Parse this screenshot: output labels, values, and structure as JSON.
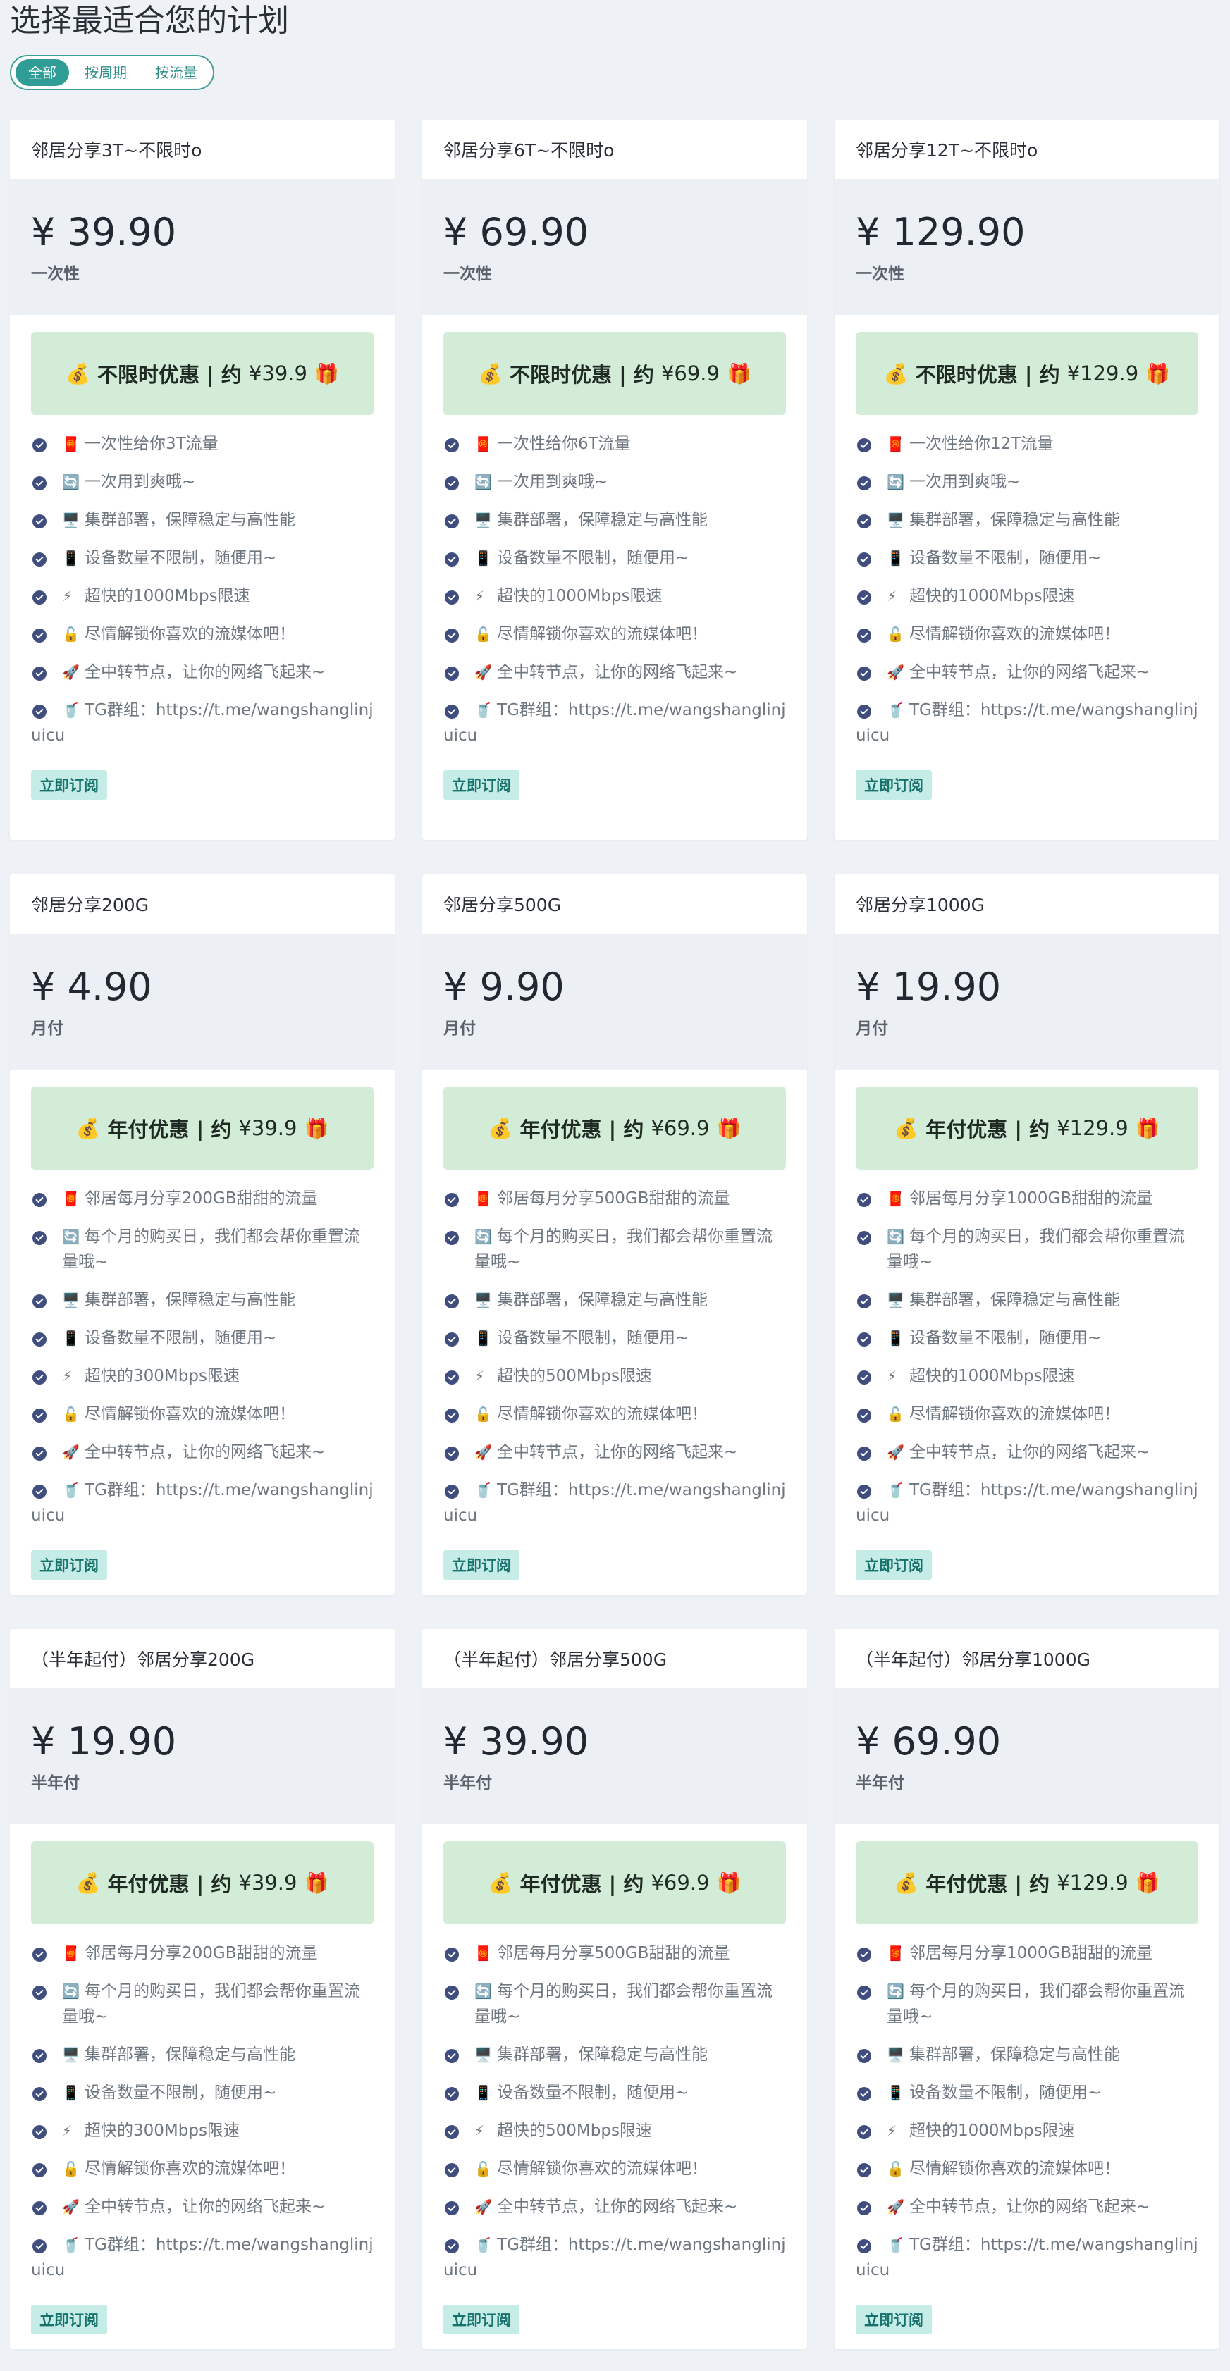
{
  "page": {
    "title": "选择最适合您的计划"
  },
  "filters": [
    {
      "label": "全部",
      "active": true
    },
    {
      "label": "按周期",
      "active": false
    },
    {
      "label": "按流量",
      "active": false
    }
  ],
  "icons": {
    "check": "check-circle-icon",
    "traffic": "🧧",
    "reset": "🔄",
    "server": "🖥️",
    "device": "📱",
    "speed": "⚡",
    "unlock": "🔓",
    "rocket": "🚀",
    "drink": "🥤",
    "money": "💰",
    "gift": "🎁"
  },
  "colors": {
    "accent": "#2f9c96",
    "promo_bg": "#d3ecd8",
    "check": "#3f4e7e"
  },
  "subscribe_label": "立即订阅",
  "plans": [
    {
      "name": "邻居分享3T~不限时o",
      "price": "¥ 39.90",
      "period": "一次性",
      "promo_title": "不限时优惠 | 约",
      "promo_amount": "¥39.9",
      "features": [
        "一次性给你3T流量",
        "一次用到爽哦~",
        "集群部署，保障稳定与高性能",
        "设备数量不限制，随便用~",
        "超快的1000Mbps限速",
        "尽情解锁你喜欢的流媒体吧！",
        "全中转节点，让你的网络飞起来~",
        "TG群组：https://t.me/wangshanglinjuicu"
      ]
    },
    {
      "name": "邻居分享6T~不限时o",
      "price": "¥ 69.90",
      "period": "一次性",
      "promo_title": "不限时优惠 | 约",
      "promo_amount": "¥69.9",
      "features": [
        "一次性给你6T流量",
        "一次用到爽哦~",
        "集群部署，保障稳定与高性能",
        "设备数量不限制，随便用~",
        "超快的1000Mbps限速",
        "尽情解锁你喜欢的流媒体吧！",
        "全中转节点，让你的网络飞起来~",
        "TG群组：https://t.me/wangshanglinjuicu"
      ]
    },
    {
      "name": "邻居分享12T~不限时o",
      "price": "¥ 129.90",
      "period": "一次性",
      "promo_title": "不限时优惠 | 约",
      "promo_amount": "¥129.9",
      "features": [
        "一次性给你12T流量",
        "一次用到爽哦~",
        "集群部署，保障稳定与高性能",
        "设备数量不限制，随便用~",
        "超快的1000Mbps限速",
        "尽情解锁你喜欢的流媒体吧！",
        "全中转节点，让你的网络飞起来~",
        "TG群组：https://t.me/wangshanglinjuicu"
      ]
    },
    {
      "name": "邻居分享200G",
      "price": "¥ 4.90",
      "period": "月付",
      "promo_title": "年付优惠 | 约",
      "promo_amount": "¥39.9",
      "features": [
        "邻居每月分享200GB甜甜的流量",
        "每个月的购买日，我们都会帮你重置流量哦~",
        "集群部署，保障稳定与高性能",
        "设备数量不限制，随便用~",
        "超快的300Mbps限速",
        "尽情解锁你喜欢的流媒体吧！",
        "全中转节点，让你的网络飞起来~",
        "TG群组：https://t.me/wangshanglinjuicu"
      ]
    },
    {
      "name": "邻居分享500G",
      "price": "¥ 9.90",
      "period": "月付",
      "promo_title": "年付优惠 | 约",
      "promo_amount": "¥69.9",
      "features": [
        "邻居每月分享500GB甜甜的流量",
        "每个月的购买日，我们都会帮你重置流量哦~",
        "集群部署，保障稳定与高性能",
        "设备数量不限制，随便用~",
        "超快的500Mbps限速",
        "尽情解锁你喜欢的流媒体吧！",
        "全中转节点，让你的网络飞起来~",
        "TG群组：https://t.me/wangshanglinjuicu"
      ]
    },
    {
      "name": "邻居分享1000G",
      "price": "¥ 19.90",
      "period": "月付",
      "promo_title": "年付优惠 | 约",
      "promo_amount": "¥129.9",
      "features": [
        "邻居每月分享1000GB甜甜的流量",
        "每个月的购买日，我们都会帮你重置流量哦~",
        "集群部署，保障稳定与高性能",
        "设备数量不限制，随便用~",
        "超快的1000Mbps限速",
        "尽情解锁你喜欢的流媒体吧！",
        "全中转节点，让你的网络飞起来~",
        "TG群组：https://t.me/wangshanglinjuicu"
      ]
    },
    {
      "name": "（半年起付）邻居分享200G",
      "price": "¥ 19.90",
      "period": "半年付",
      "promo_title": "年付优惠 | 约",
      "promo_amount": "¥39.9",
      "features": [
        "邻居每月分享200GB甜甜的流量",
        "每个月的购买日，我们都会帮你重置流量哦~",
        "集群部署，保障稳定与高性能",
        "设备数量不限制，随便用~",
        "超快的300Mbps限速",
        "尽情解锁你喜欢的流媒体吧！",
        "全中转节点，让你的网络飞起来~",
        "TG群组：https://t.me/wangshanglinjuicu"
      ]
    },
    {
      "name": "（半年起付）邻居分享500G",
      "price": "¥ 39.90",
      "period": "半年付",
      "promo_title": "年付优惠 | 约",
      "promo_amount": "¥69.9",
      "features": [
        "邻居每月分享500GB甜甜的流量",
        "每个月的购买日，我们都会帮你重置流量哦~",
        "集群部署，保障稳定与高性能",
        "设备数量不限制，随便用~",
        "超快的500Mbps限速",
        "尽情解锁你喜欢的流媒体吧！",
        "全中转节点，让你的网络飞起来~",
        "TG群组：https://t.me/wangshanglinjuicu"
      ]
    },
    {
      "name": "（半年起付）邻居分享1000G",
      "price": "¥ 69.90",
      "period": "半年付",
      "promo_title": "年付优惠 | 约",
      "promo_amount": "¥129.9",
      "features": [
        "邻居每月分享1000GB甜甜的流量",
        "每个月的购买日，我们都会帮你重置流量哦~",
        "集群部署，保障稳定与高性能",
        "设备数量不限制，随便用~",
        "超快的1000Mbps限速",
        "尽情解锁你喜欢的流媒体吧！",
        "全中转节点，让你的网络飞起来~",
        "TG群组：https://t.me/wangshanglinjuicu"
      ]
    }
  ]
}
